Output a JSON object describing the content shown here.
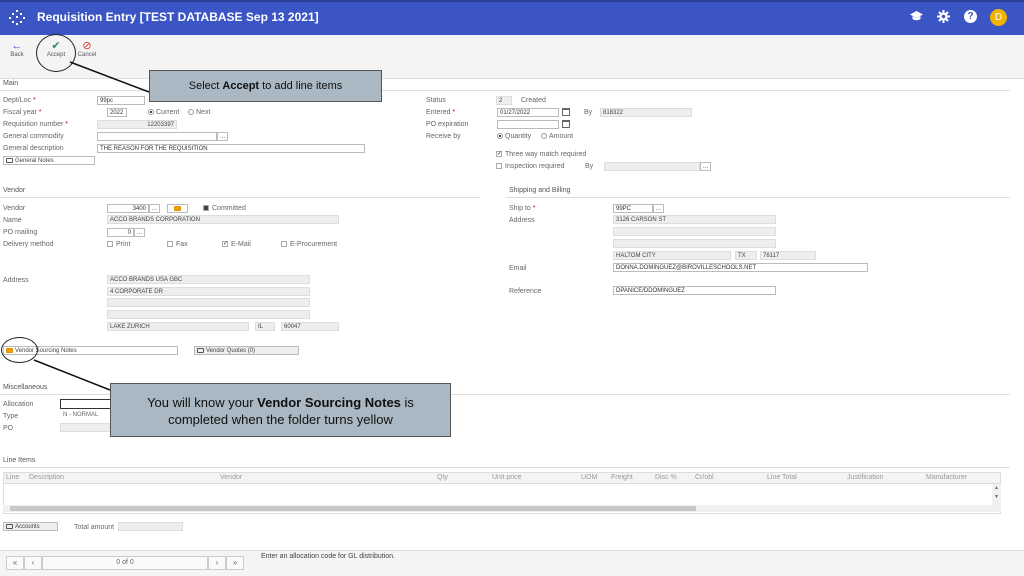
{
  "header": {
    "title": "Requisition Entry [TEST DATABASE Sep 13 2021]",
    "avatar_letter": "D"
  },
  "toolbar": {
    "back_label": "Back",
    "accept_label": "Accept",
    "cancel_label": "Cancel"
  },
  "main": {
    "section_title": "Main",
    "dept_label": "Dept/Loc",
    "dept_value": "99pc",
    "fiscal_label": "Fiscal year",
    "fiscal_value": "2022",
    "current_label": "Current",
    "next_label": "Next",
    "reqnum_label": "Requisition number",
    "reqnum_value": "12203397",
    "commodity_label": "General commodity",
    "description_label": "General description",
    "description_value": "THE REASON FOR THE REQUISITION",
    "general_notes_label": "General Notes",
    "status_label": "Status",
    "status_code": "2",
    "status_text": "Created",
    "entered_label": "Entered",
    "entered_value": "01/27/2022",
    "by_label": "By",
    "by_value": "818322",
    "po_expiration_label": "PO expiration",
    "receive_by_label": "Receive by",
    "quantity_label": "Quantity",
    "amount_label": "Amount",
    "three_way_label": "Three way match required",
    "inspection_label": "Inspection required",
    "inspection_by_label": "By"
  },
  "vendor": {
    "section_title": "Vendor",
    "vendor_label": "Vendor",
    "vendor_value": "3400",
    "committed_label": "Committed",
    "name_label": "Name",
    "name_value": "ACCO BRANDS CORPORATION",
    "po_mailing_label": "PO mailing",
    "po_mailing_value": "0",
    "delivery_label": "Delivery method",
    "print_label": "Print",
    "fax_label": "Fax",
    "email_label": "E-Mail",
    "eproc_label": "E-Procurement",
    "address_label": "Address",
    "address_line1": "ACCO BRANDS USA GBC",
    "address_line2": "4 CORPORATE DR",
    "city": "LAKE ZURICH",
    "state": "IL",
    "zip": "60047",
    "sourcing_notes_label": "Vendor Sourcing Notes",
    "vendor_quotes_label": "Vendor Quotes (0)"
  },
  "shipping": {
    "section_title": "Shipping and Billing",
    "ship_to_label": "Ship to",
    "ship_to_value": "99PC",
    "address_label": "Address",
    "address_line1": "3126 CARSON ST",
    "city": "HALTOM CITY",
    "state": "TX",
    "zip": "76117",
    "email_label": "Email",
    "email_value": "DONNA.DOMINGUEZ@BIROVILLESCHOOLS.NET",
    "reference_label": "Reference",
    "reference_value": "DPANICE/DDOMINGUEZ"
  },
  "misc": {
    "section_title": "Miscellaneous",
    "allocation_label": "Allocation",
    "type_label": "Type",
    "type_value": "N - NORMAL",
    "po_label": "PO"
  },
  "line_items": {
    "section_title": "Line Items",
    "columns": [
      "Line",
      "Description",
      "Vendor",
      "Qty",
      "Unit price",
      "UOM",
      "Freight",
      "Disc %",
      "Cr/obl",
      "Line Total",
      "Justification",
      "Manufacturer"
    ]
  },
  "footer": {
    "accounts_label": "Accounts",
    "total_amount_label": "Total amount",
    "pager_text": "0 of 0",
    "status_message": "Enter an allocation code for GL distribution."
  },
  "callouts": {
    "accept": {
      "prefix": "Select ",
      "bold": "Accept",
      "suffix": " to add line items"
    },
    "vendor": {
      "prefix": "You will know your ",
      "bold": "Vendor Sourcing Notes",
      "suffix": " is completed when the folder turns yellow"
    }
  },
  "colors": {
    "header_bg": "#3b55c4",
    "accept_green": "#2e8b57",
    "cancel_red": "#d9372b",
    "folder_yellow": "#f0a000",
    "callout_bg": "#a9b8c2",
    "avatar": "#f0b400"
  }
}
